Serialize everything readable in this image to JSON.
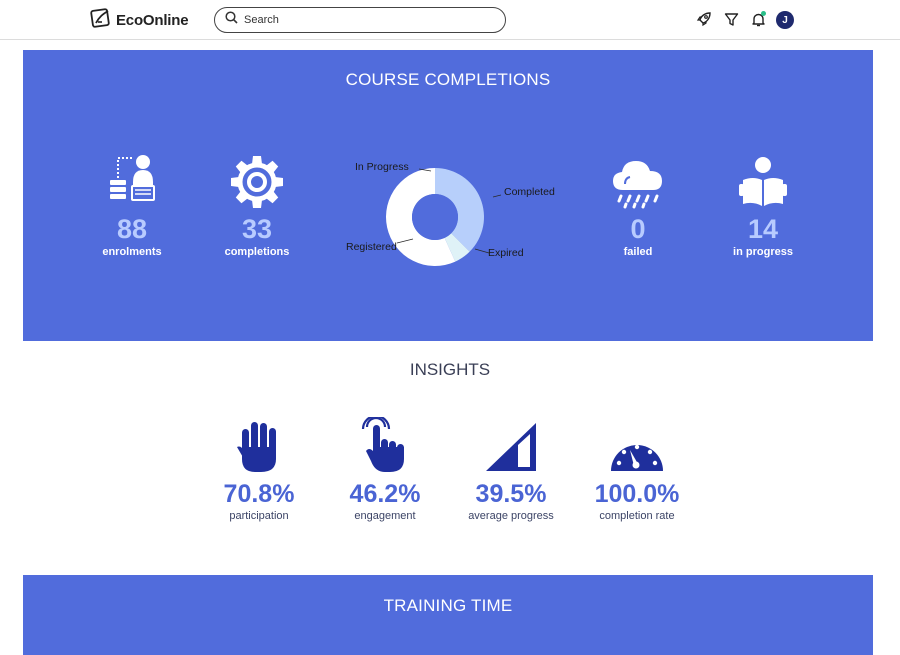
{
  "header": {
    "brand": "EcoOnline",
    "search_placeholder": "Search",
    "icons": [
      "rocket-icon",
      "filter-icon",
      "bell-icon",
      "apps-grid-icon"
    ],
    "avatar_initial": "J"
  },
  "course_completions": {
    "title": "COURSE COMPLETIONS",
    "stats": [
      {
        "value": "88",
        "label": "enrolments",
        "icon": "student-reading-icon"
      },
      {
        "value": "33",
        "label": "completions",
        "icon": "gear-icon"
      },
      {
        "value": "0",
        "label": "failed",
        "icon": "rain-cloud-icon"
      },
      {
        "value": "14",
        "label": "in progress",
        "icon": "person-reading-icon"
      }
    ],
    "chart_data": {
      "type": "pie",
      "labels": [
        "Completed",
        "Expired",
        "Registered",
        "In Progress"
      ],
      "values": [
        37.5,
        5.7,
        56.8,
        0
      ],
      "colors": [
        "#b7cffb",
        "#dff2f7",
        "#ffffff",
        "#ffffff"
      ],
      "hole": true
    }
  },
  "insights": {
    "title": "INSIGHTS",
    "items": [
      {
        "value": "70.8%",
        "label": "participation",
        "icon": "raised-hand-icon"
      },
      {
        "value": "46.2%",
        "label": "engagement",
        "icon": "tap-hand-icon"
      },
      {
        "value": "39.5%",
        "label": "average progress",
        "icon": "progress-ramp-icon"
      },
      {
        "value": "100.0%",
        "label": "completion rate",
        "icon": "speedometer-icon"
      }
    ]
  },
  "training_time": {
    "title": "TRAINING TIME"
  }
}
